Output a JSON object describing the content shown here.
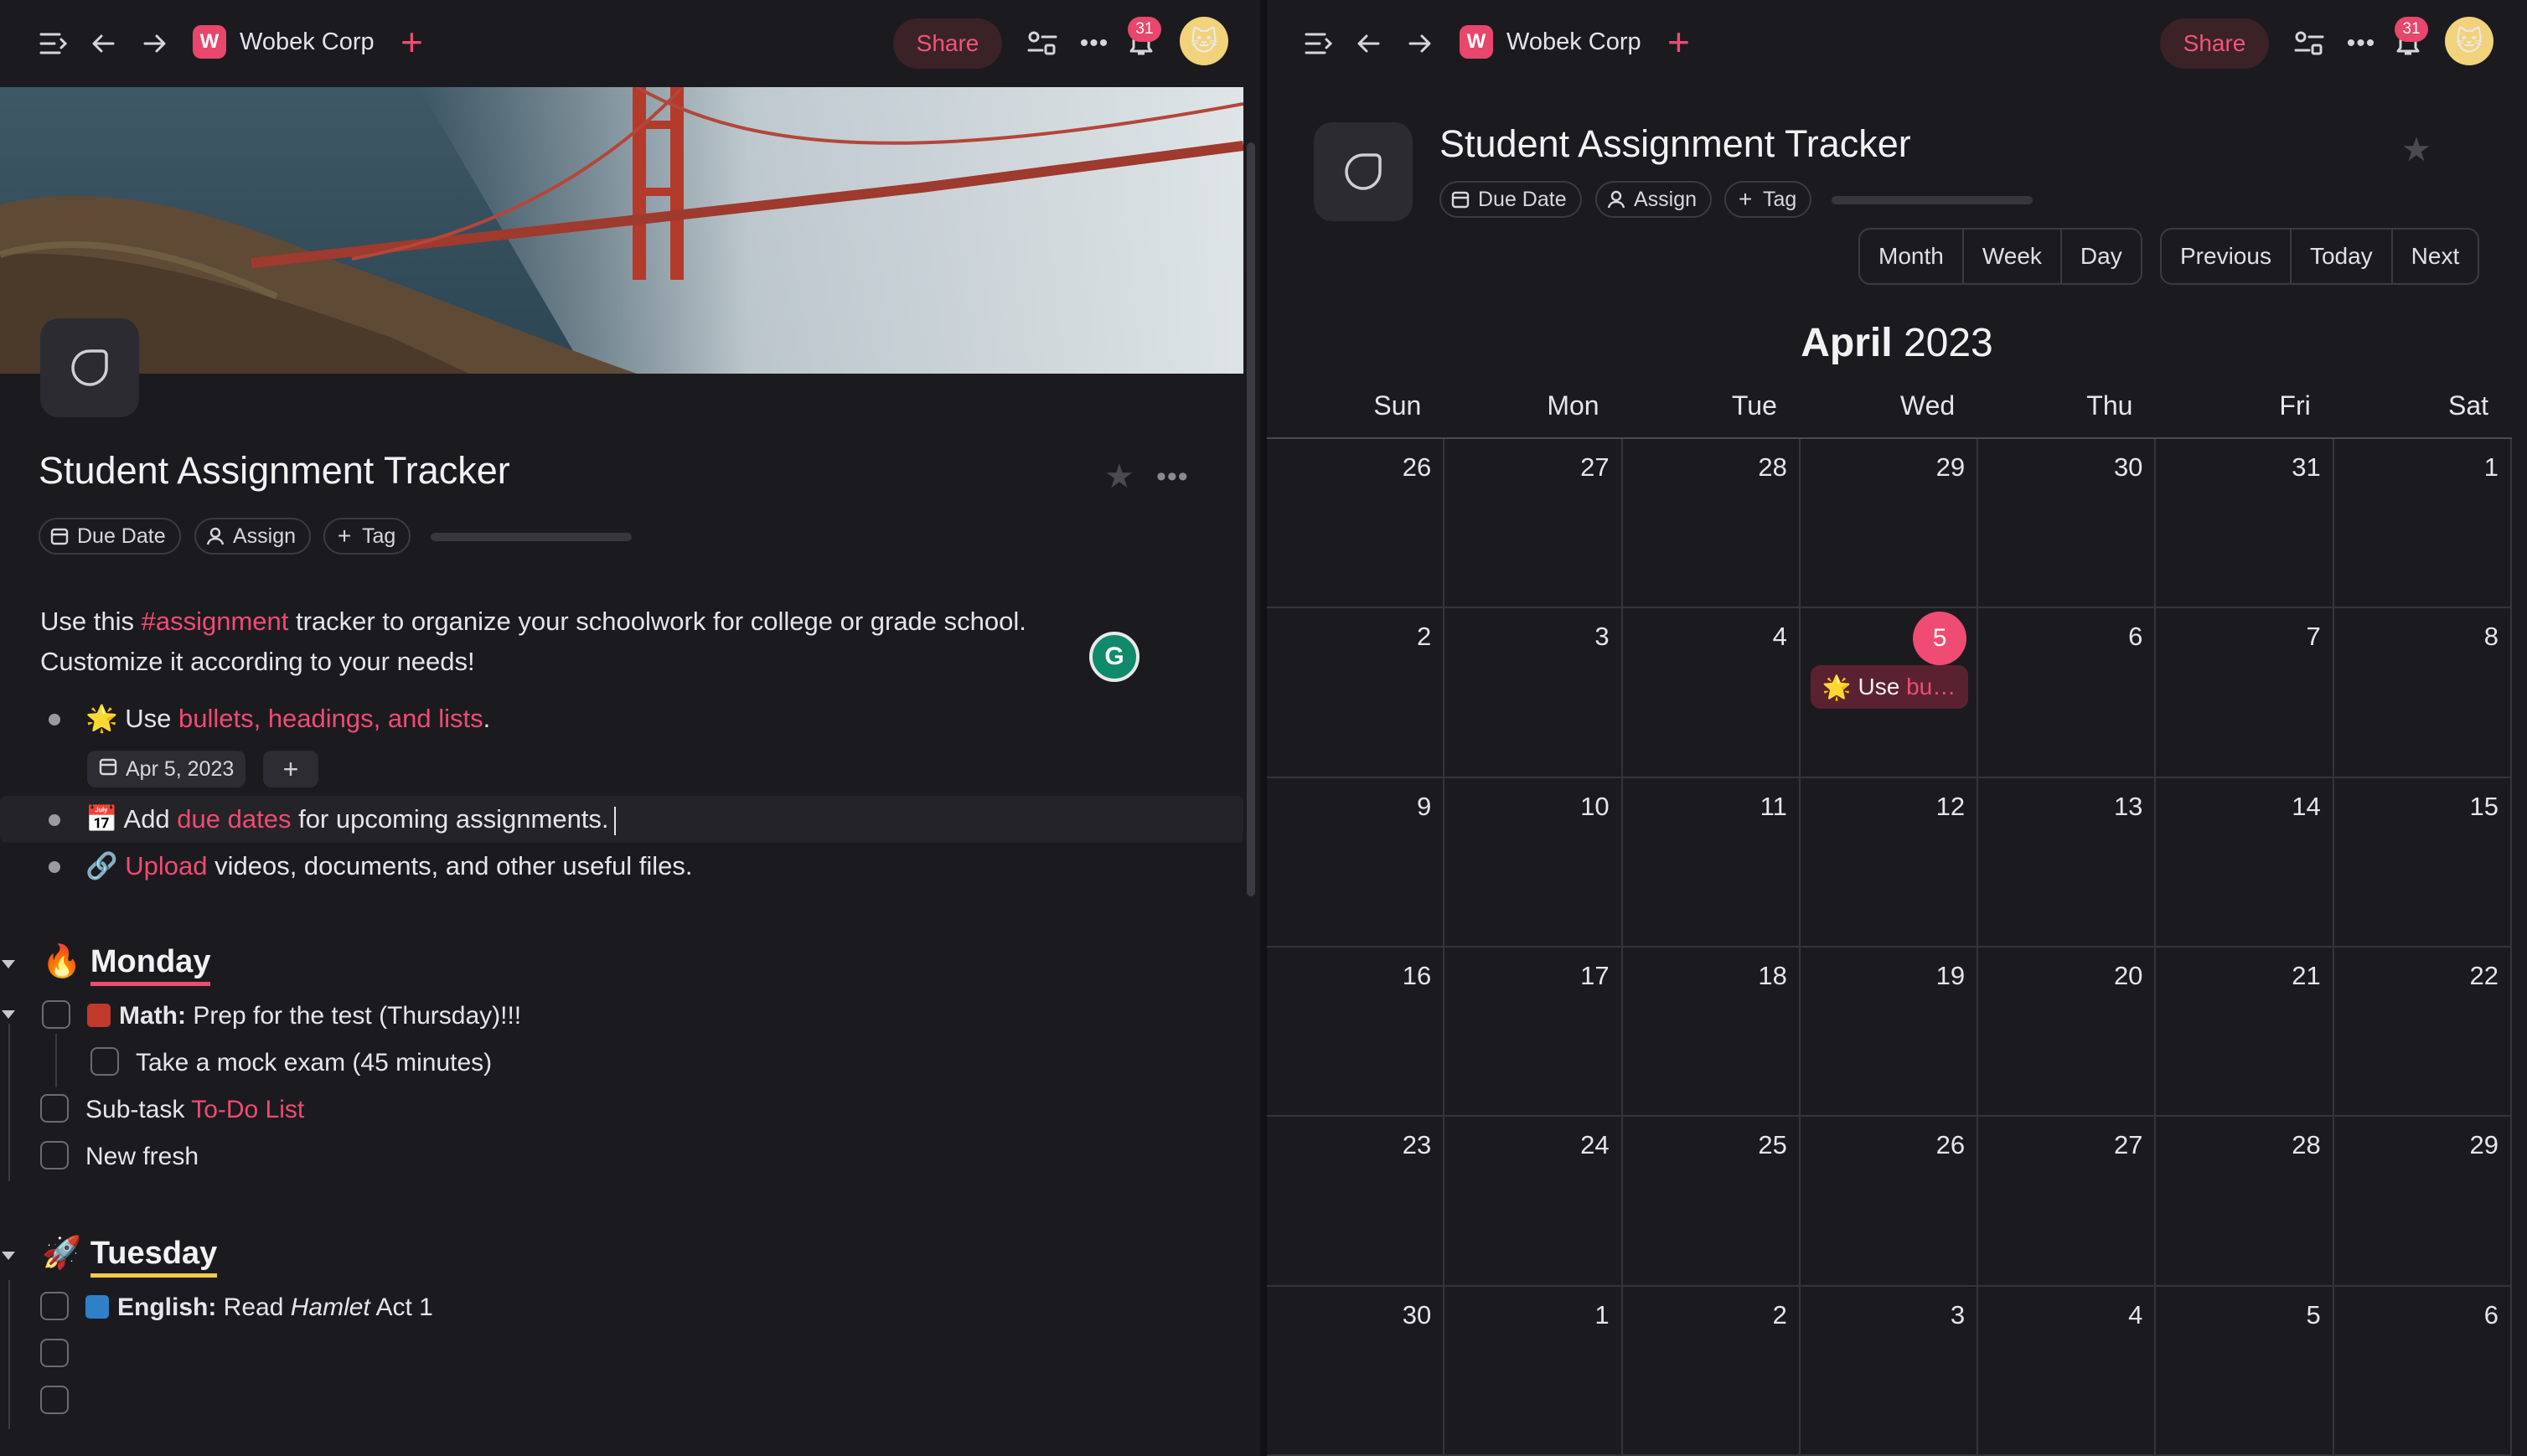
{
  "topbar": {
    "workspace_initial": "W",
    "workspace_name": "Wobek Corp",
    "share_label": "Share",
    "notification_count": "31",
    "more_glyph": "•••"
  },
  "doc": {
    "title": "Student Assignment Tracker",
    "chips": {
      "due_date": "Due Date",
      "assign": "Assign",
      "tag": "Tag"
    },
    "intro_before": "Use this ",
    "intro_tag": "#assignment",
    "intro_after": " tracker to organize your schoolwork for college or grade school.",
    "intro_line2": "Customize it according to your needs!",
    "bullets": [
      {
        "emoji": "🌟",
        "before": "Use ",
        "link": "bullets, headings, and lists",
        "after": "."
      },
      {
        "emoji": "📅",
        "before": "Add ",
        "link": "due dates",
        "after": " for upcoming assignments."
      },
      {
        "emoji": "🔗",
        "before": "",
        "link": "Upload",
        "after": " videos, documents, and other useful files."
      }
    ],
    "date_chip": "Apr 5, 2023",
    "grammarly": "G"
  },
  "monday": {
    "emoji": "🔥",
    "title": "Monday",
    "underline_color": "#f04b72",
    "task1_bold": "Math:",
    "task1_text": " Prep for the test (Thursday)!!!",
    "subtask": "Take a mock exam (45 minutes)",
    "task2_before": "Sub-task ",
    "task2_link": "To-Do List",
    "task3_link": "New fresh"
  },
  "tuesday": {
    "emoji": "🚀",
    "title": "Tuesday",
    "underline_color": "#f2c94c",
    "task1_bold": "English:",
    "task1_before": " Read ",
    "task1_italic": "Hamlet",
    "task1_after": " Act 1"
  },
  "calendar": {
    "view_buttons": {
      "month": "Month",
      "week": "Week",
      "day": "Day"
    },
    "nav_buttons": {
      "previous": "Previous",
      "today": "Today",
      "next": "Next"
    },
    "month_name": "April",
    "year": "2023",
    "days_of_week": [
      "Sun",
      "Mon",
      "Tue",
      "Wed",
      "Thu",
      "Fri",
      "Sat"
    ],
    "weeks": [
      [
        "26",
        "27",
        "28",
        "29",
        "30",
        "31",
        "1"
      ],
      [
        "2",
        "3",
        "4",
        "5",
        "6",
        "7",
        "8"
      ],
      [
        "9",
        "10",
        "11",
        "12",
        "13",
        "14",
        "15"
      ],
      [
        "16",
        "17",
        "18",
        "19",
        "20",
        "21",
        "22"
      ],
      [
        "23",
        "24",
        "25",
        "26",
        "27",
        "28",
        "29"
      ],
      [
        "30",
        "1",
        "2",
        "3",
        "4",
        "5",
        "6"
      ]
    ],
    "today": "5",
    "event": {
      "emoji": "🌟",
      "before": "Use ",
      "link": "bu…"
    }
  },
  "colors": {
    "accent": "#f04b72",
    "background": "#1b1b1f"
  }
}
